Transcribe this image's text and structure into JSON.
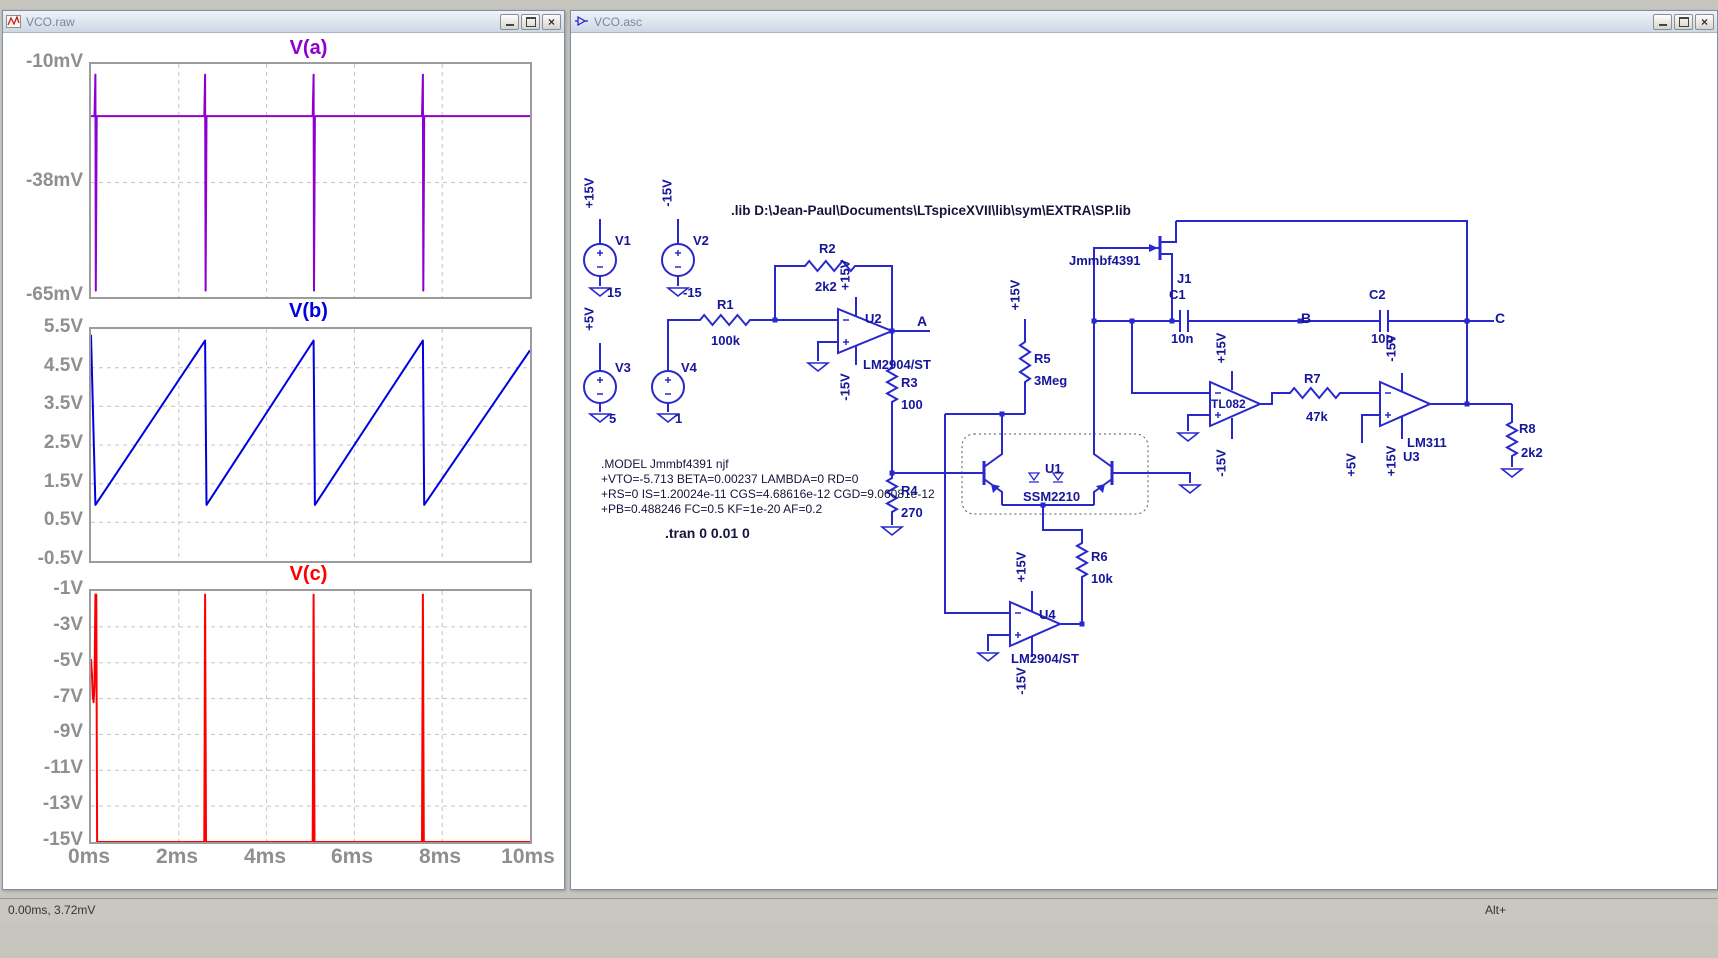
{
  "app": {
    "status_left": "0.00ms, 3.72mV",
    "status_right": "Alt+"
  },
  "raw_window": {
    "title": "VCO.raw"
  },
  "asc_window": {
    "title": "VCO.asc"
  },
  "x_axis": {
    "labels": [
      "0ms",
      "2ms",
      "4ms",
      "6ms",
      "8ms",
      "10ms"
    ]
  },
  "chart_data": [
    {
      "type": "line",
      "title": "V(a)",
      "color": "#8d00d0",
      "y_unit": "mV",
      "xlim": [
        0,
        10
      ],
      "ylim": [
        -10,
        -65
      ],
      "xticks": [
        0,
        2,
        4,
        6,
        8,
        10
      ],
      "yticks": [
        [
          -10,
          "-10mV"
        ],
        [
          -38,
          "-38mV"
        ],
        [
          -65,
          "-65mV"
        ]
      ],
      "points": [
        [
          0,
          -22.3
        ],
        [
          0.08,
          -22.3
        ],
        [
          0.1,
          -12.5
        ],
        [
          0.11,
          -63.5
        ],
        [
          0.13,
          -22.3
        ],
        [
          2.58,
          -22.3
        ],
        [
          2.6,
          -12.5
        ],
        [
          2.61,
          -63.5
        ],
        [
          2.63,
          -22.3
        ],
        [
          5.05,
          -22.3
        ],
        [
          5.07,
          -12.5
        ],
        [
          5.08,
          -63.5
        ],
        [
          5.1,
          -22.3
        ],
        [
          7.54,
          -22.3
        ],
        [
          7.56,
          -12.5
        ],
        [
          7.57,
          -63.5
        ],
        [
          7.59,
          -22.3
        ],
        [
          10,
          -22.3
        ]
      ]
    },
    {
      "type": "line",
      "title": "V(b)",
      "color": "#0000e0",
      "y_unit": "V",
      "xlim": [
        0,
        10
      ],
      "ylim": [
        5.5,
        -0.5
      ],
      "xticks": [
        0,
        2,
        4,
        6,
        8,
        10
      ],
      "yticks": [
        [
          5.5,
          "5.5V"
        ],
        [
          4.5,
          "4.5V"
        ],
        [
          3.5,
          "3.5V"
        ],
        [
          2.5,
          "2.5V"
        ],
        [
          1.5,
          "1.5V"
        ],
        [
          0.5,
          "0.5V"
        ],
        [
          -0.5,
          "-0.5V"
        ]
      ],
      "points": [
        [
          0,
          5.35
        ],
        [
          0.1,
          0.95
        ],
        [
          2.6,
          5.2
        ],
        [
          2.63,
          0.95
        ],
        [
          5.07,
          5.2
        ],
        [
          5.1,
          0.95
        ],
        [
          7.56,
          5.2
        ],
        [
          7.59,
          0.95
        ],
        [
          10,
          4.95
        ]
      ]
    },
    {
      "type": "line",
      "title": "V(c)",
      "color": "#ff0000",
      "y_unit": "V",
      "xlim": [
        0,
        10
      ],
      "ylim": [
        -1,
        -15
      ],
      "xticks": [
        0,
        2,
        4,
        6,
        8,
        10
      ],
      "yticks": [
        [
          -1,
          "-1V"
        ],
        [
          -3,
          "-3V"
        ],
        [
          -5,
          "-5V"
        ],
        [
          -7,
          "-7V"
        ],
        [
          -9,
          "-9V"
        ],
        [
          -11,
          "-11V"
        ],
        [
          -13,
          "-13V"
        ],
        [
          -15,
          "-15V"
        ]
      ],
      "points": [
        [
          0,
          -4.8
        ],
        [
          0.02,
          -5.6
        ],
        [
          0.04,
          -6.9
        ],
        [
          0.06,
          -7.2
        ],
        [
          0.08,
          -6.3
        ],
        [
          0.1,
          -1.2
        ],
        [
          0.12,
          -1.2
        ],
        [
          0.14,
          -15
        ],
        [
          2.58,
          -15
        ],
        [
          2.6,
          -1.2
        ],
        [
          2.62,
          -15
        ],
        [
          5.05,
          -15
        ],
        [
          5.07,
          -1.2
        ],
        [
          5.09,
          -15
        ],
        [
          7.54,
          -15
        ],
        [
          7.56,
          -1.2
        ],
        [
          7.58,
          -15
        ],
        [
          10,
          -15
        ]
      ]
    }
  ],
  "schematic": {
    "directives": {
      "lib": ".lib D:\\Jean-Paul\\Documents\\LTspiceXVII\\lib\\sym\\EXTRA\\SP.lib",
      "model_1": ".MODEL Jmmbf4391 njf",
      "model_2": "+VTO=-5.713 BETA=0.00237 LAMBDA=0 RD=0",
      "model_3": "+RS=0 IS=1.20024e-11 CGS=4.68616e-12 CGD=9.06081e-12",
      "model_4": "+PB=0.488246 FC=0.5 KF=1e-20 AF=0.2",
      "tran": ".tran 0 0.01 0"
    },
    "rails": {
      "p15": "+15V",
      "n15": "-15V",
      "p5": "+5V"
    },
    "ports": {
      "a": "A",
      "b": "B",
      "c": "C"
    },
    "components": {
      "v1": {
        "name": "V1",
        "value": "15"
      },
      "v2": {
        "name": "V2",
        "value": "-15"
      },
      "v3": {
        "name": "V3",
        "value": "5"
      },
      "v4": {
        "name": "V4",
        "value": "1"
      },
      "r1": {
        "name": "R1",
        "value": "100k"
      },
      "r2": {
        "name": "R2",
        "value": "2k2"
      },
      "r3": {
        "name": "R3",
        "value": "100"
      },
      "r4": {
        "name": "R4",
        "value": "270"
      },
      "r5": {
        "name": "R5",
        "value": "3Meg"
      },
      "r6": {
        "name": "R6",
        "value": "10k"
      },
      "r7": {
        "name": "R7",
        "value": "47k"
      },
      "r8": {
        "name": "R8",
        "value": "2k2"
      },
      "c1": {
        "name": "C1",
        "value": "10n"
      },
      "c2": {
        "name": "C2",
        "value": "10p"
      },
      "u1": {
        "name": "U1",
        "model": "SSM2210"
      },
      "u2": {
        "name": "U2",
        "model": "LM2904/ST"
      },
      "u3": {
        "name": "U3",
        "model": "LM311"
      },
      "u4": {
        "name": "U4",
        "model": "LM2904/ST"
      },
      "u5": {
        "model": "TL082"
      },
      "j1": {
        "name": "J1",
        "model": "Jmmbf4391"
      }
    }
  }
}
